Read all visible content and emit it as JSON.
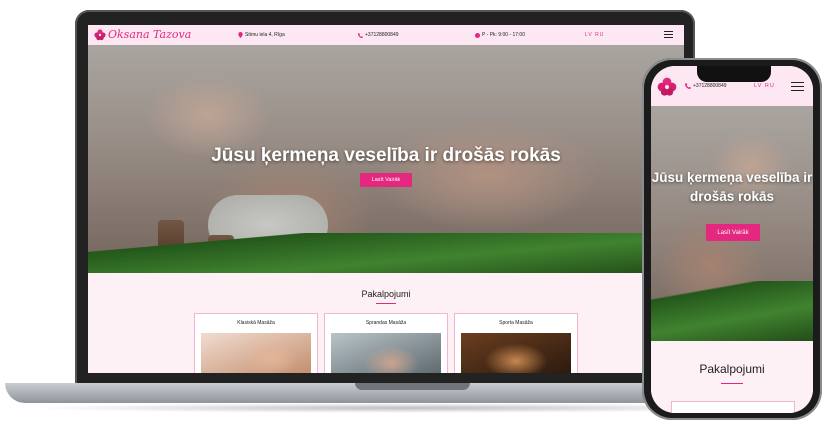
{
  "laptop": {
    "brand": "Oksana Tazova",
    "address": "Stirnu iela 4, Rīga",
    "phone": "+37128800849",
    "hours": "P - Pk: 9:00 - 17:00",
    "lang_lv": "LV",
    "lang_ru": "RU",
    "hero_title": "Jūsu ķermeņa veselība ir drošās rokās",
    "hero_button": "Lasīt Vairāk",
    "services_title": "Pakalpojumi",
    "cards": [
      {
        "title": "Klasiskā Masāža"
      },
      {
        "title": "Sprandas Masāža"
      },
      {
        "title": "Sporta Masāža"
      }
    ]
  },
  "phone": {
    "phone": "+37128800849",
    "lang_lv": "LV",
    "lang_ru": "RU",
    "hero_title": "Jūsu ķermeņa veselība ir drošās rokās",
    "hero_button": "Lasīt Vairāk",
    "services_title": "Pakalpojumi"
  },
  "colors": {
    "accent": "#e4287f",
    "nav_bg": "#fde7f2",
    "section_bg": "#fdf1f6"
  },
  "icons": [
    "orchid-logo-icon",
    "location-pin-icon",
    "phone-icon",
    "clock-icon",
    "hamburger-menu-icon"
  ]
}
